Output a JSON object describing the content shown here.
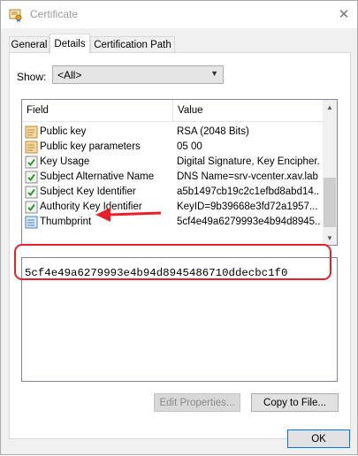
{
  "window": {
    "title": "Certificate",
    "close_glyph": "✕"
  },
  "tabs": [
    {
      "label": "General",
      "active": false
    },
    {
      "label": "Details",
      "active": true
    },
    {
      "label": "Certification Path",
      "active": false
    }
  ],
  "show": {
    "label": "Show:",
    "value": "<All>"
  },
  "list": {
    "header": {
      "field": "Field",
      "value": "Value"
    },
    "rows": [
      {
        "field": "Public key",
        "value": "RSA (2048 Bits)",
        "icon": "cert-field-icon"
      },
      {
        "field": "Public key parameters",
        "value": "05 00",
        "icon": "cert-field-icon"
      },
      {
        "field": "Key Usage",
        "value": "Digital Signature, Key Encipher...",
        "icon": "extension-icon"
      },
      {
        "field": "Subject Alternative Name",
        "value": "DNS Name=srv-vcenter.xav.lab",
        "icon": "extension-icon"
      },
      {
        "field": "Subject Key Identifier",
        "value": "a5b1497cb19c2c1efbd8abd14...",
        "icon": "extension-icon"
      },
      {
        "field": "Authority Key Identifier",
        "value": "KeyID=9b39668e3fd72a1957...",
        "icon": "extension-icon"
      },
      {
        "field": "Thumbprint",
        "value": "5cf4e49a6279993e4b94d8945...",
        "icon": "property-icon"
      }
    ]
  },
  "detail": {
    "text": "5cf4e49a6279993e4b94d8945486710ddecbc1f0"
  },
  "buttons": {
    "edit_properties": "Edit Properties...",
    "copy_to_file": "Copy to File...",
    "ok": "OK"
  },
  "colors": {
    "annotation": "#e8202a",
    "selection_accent": "#0078d7"
  }
}
